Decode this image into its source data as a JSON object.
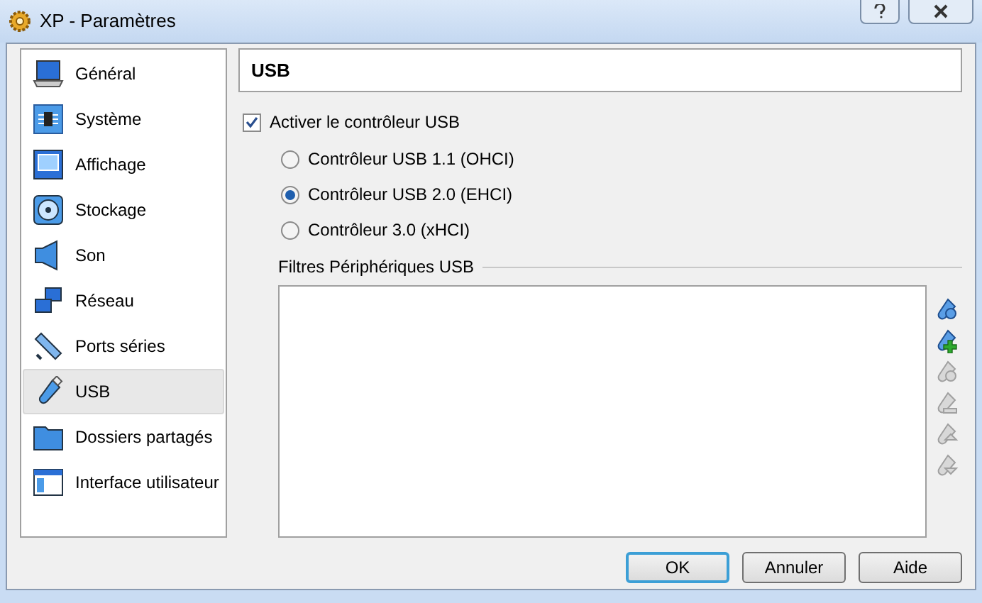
{
  "window": {
    "title": "XP - Paramètres"
  },
  "sidebar": {
    "items": [
      {
        "label": "Général",
        "kind": "general",
        "selected": false
      },
      {
        "label": "Système",
        "kind": "system",
        "selected": false
      },
      {
        "label": "Affichage",
        "kind": "display",
        "selected": false
      },
      {
        "label": "Stockage",
        "kind": "storage",
        "selected": false
      },
      {
        "label": "Son",
        "kind": "audio",
        "selected": false
      },
      {
        "label": "Réseau",
        "kind": "network",
        "selected": false
      },
      {
        "label": "Ports séries",
        "kind": "serial",
        "selected": false
      },
      {
        "label": "USB",
        "kind": "usb",
        "selected": true
      },
      {
        "label": "Dossiers partagés",
        "kind": "folder",
        "selected": false
      },
      {
        "label": "Interface utilisateur",
        "kind": "ui",
        "selected": false
      }
    ]
  },
  "page": {
    "title": "USB",
    "enable_usb": {
      "label": "Activer le contrôleur USB",
      "checked": true
    },
    "controllers": [
      {
        "label": "Contrôleur USB 1.1 (OHCI)",
        "selected": false
      },
      {
        "label": "Contrôleur USB 2.0 (EHCI)",
        "selected": true
      },
      {
        "label": "Contrôleur 3.0 (xHCI)",
        "selected": false
      }
    ],
    "filters": {
      "label": "Filtres Périphériques USB",
      "tools": [
        {
          "kind": "add",
          "disabled": false
        },
        {
          "kind": "add-device",
          "disabled": false
        },
        {
          "kind": "edit",
          "disabled": true
        },
        {
          "kind": "remove",
          "disabled": true
        },
        {
          "kind": "up",
          "disabled": true
        },
        {
          "kind": "down",
          "disabled": true
        }
      ]
    }
  },
  "buttons": [
    {
      "label": "OK",
      "default": true
    },
    {
      "label": "Annuler",
      "default": false
    },
    {
      "label": "Aide",
      "default": false
    }
  ]
}
